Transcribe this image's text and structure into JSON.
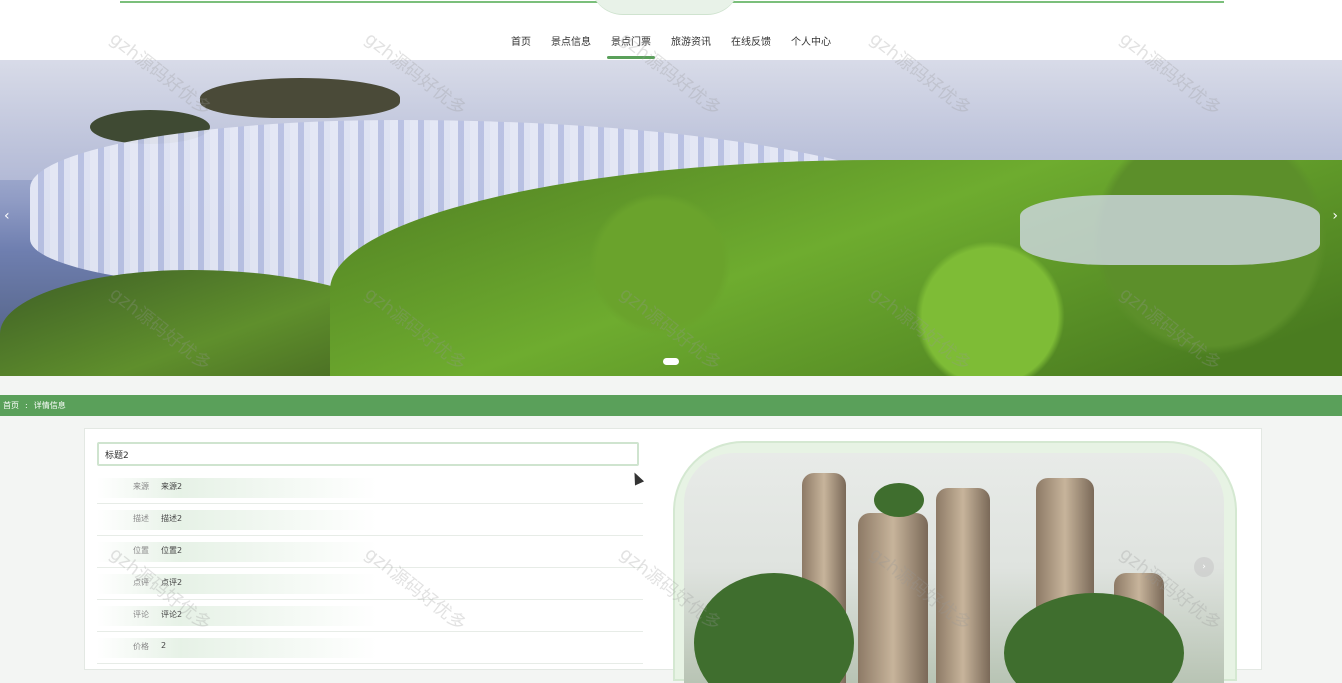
{
  "nav": {
    "items": [
      {
        "label": "首页"
      },
      {
        "label": "景点信息"
      },
      {
        "label": "景点门票"
      },
      {
        "label": "旅游资讯"
      },
      {
        "label": "在线反馈"
      },
      {
        "label": "个人中心"
      }
    ],
    "active_index": 2
  },
  "banner": {
    "prev_glyph": "‹",
    "next_glyph": "›",
    "slide_count": 1,
    "active_slide": 1
  },
  "breadcrumb": {
    "home": "首页",
    "separator": ":",
    "current": "详情信息"
  },
  "detail": {
    "title": "标题2",
    "rows": [
      {
        "label": "来源",
        "value": "来源2"
      },
      {
        "label": "描述",
        "value": "描述2"
      },
      {
        "label": "位置",
        "value": "位置2"
      },
      {
        "label": "点评",
        "value": "点评2"
      },
      {
        "label": "评论",
        "value": "评论2"
      },
      {
        "label": "价格",
        "value": "2"
      }
    ],
    "image_next_glyph": "›"
  },
  "watermark": {
    "text": "gzh源码好优多"
  },
  "colors": {
    "accent": "#5aa05a",
    "frame": "#e7f3e4"
  }
}
